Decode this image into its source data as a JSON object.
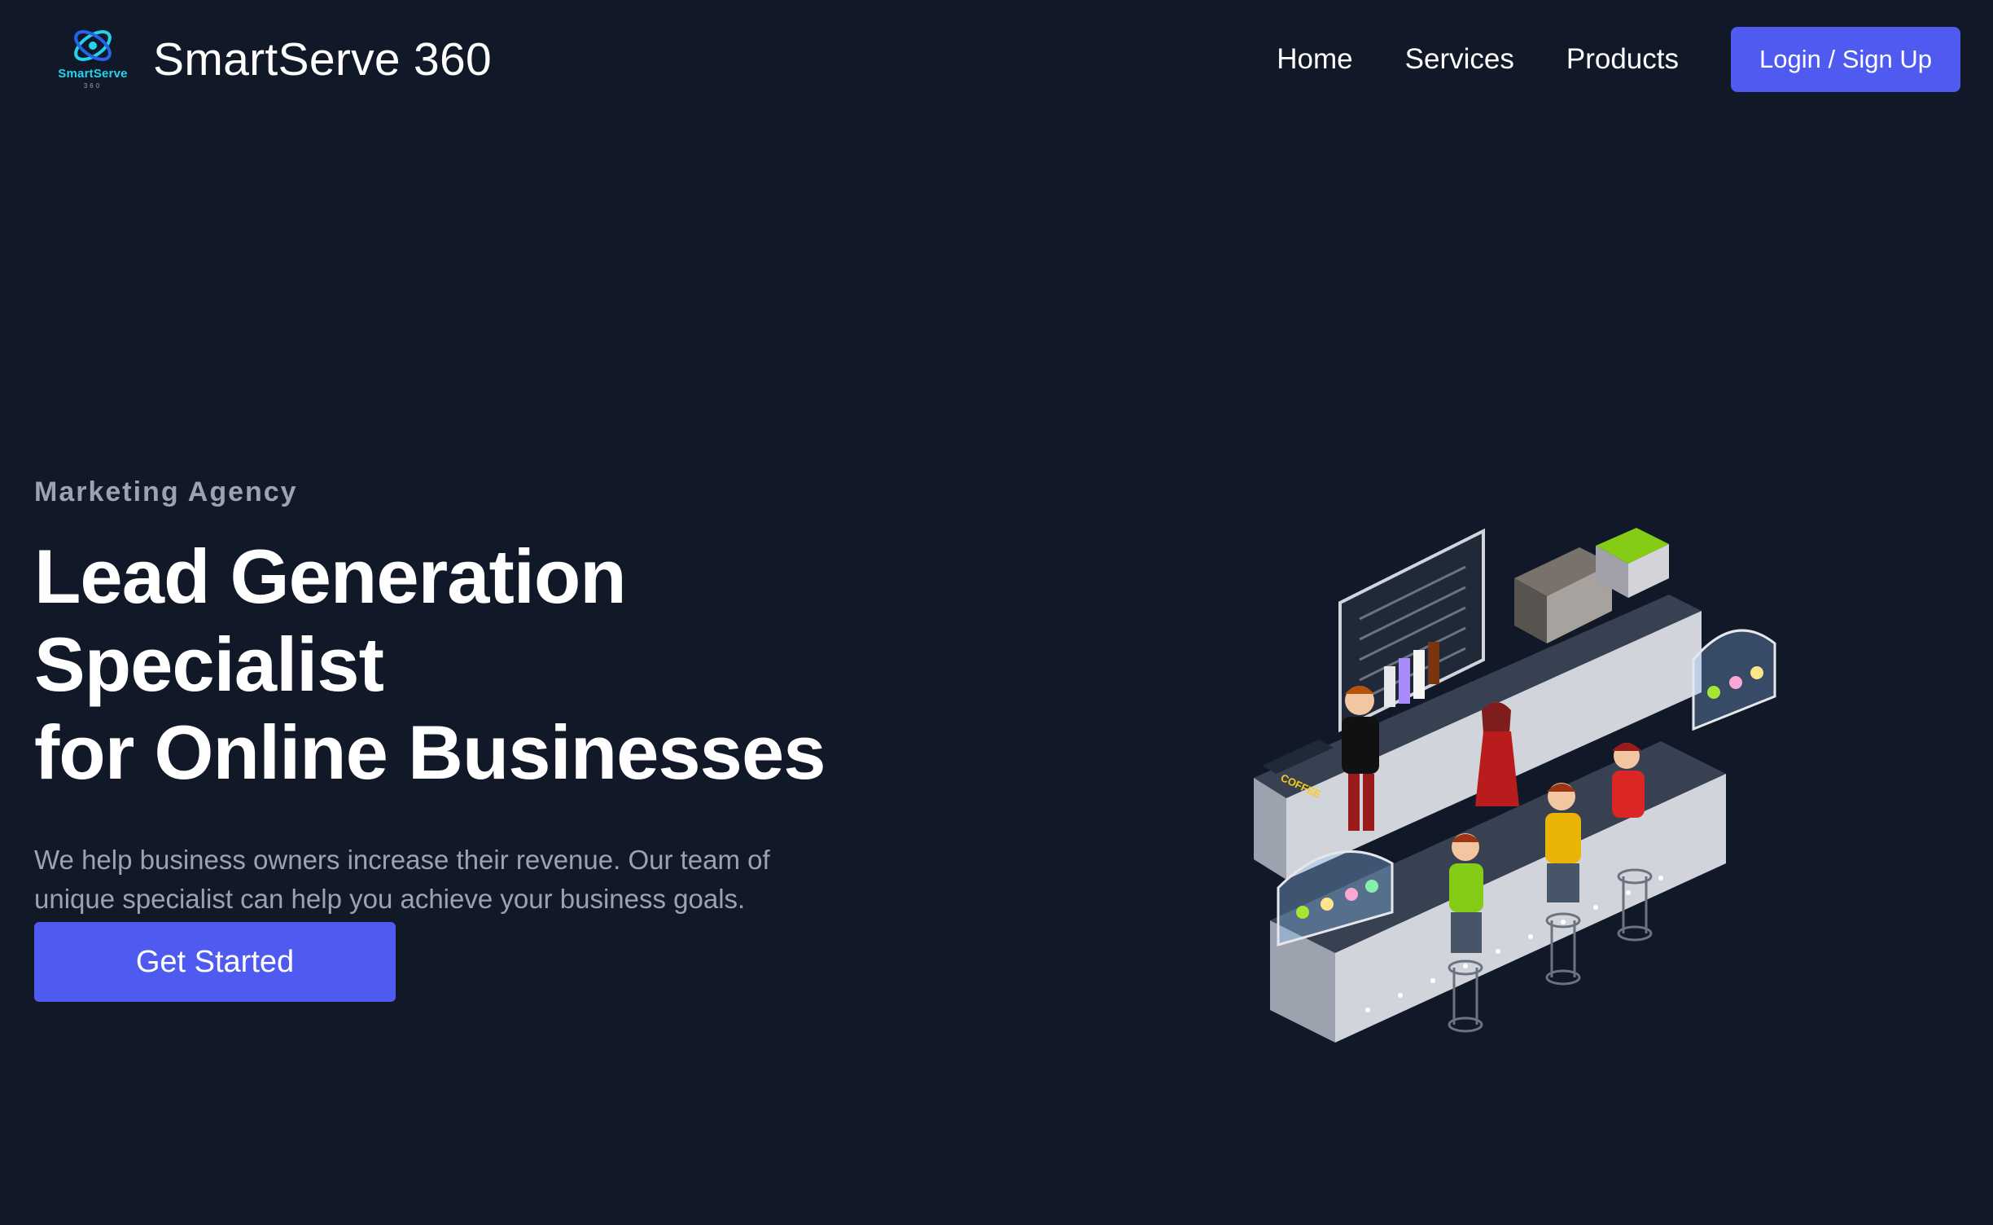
{
  "brand": {
    "logo_text": "SmartServe",
    "logo_subtext": "360",
    "name": "SmartServe 360",
    "accent_color": "#22d3ee"
  },
  "nav": {
    "items": [
      {
        "label": "Home"
      },
      {
        "label": "Services"
      },
      {
        "label": "Products"
      }
    ],
    "login_label": "Login / Sign Up"
  },
  "hero": {
    "eyebrow": "Marketing Agency",
    "headline_line1": "Lead Generation Specialist",
    "headline_line2": "for Online Businesses",
    "description": "We help business owners increase their revenue. Our team of unique specialist can help you achieve your business goals.",
    "cta_label": "Get Started"
  },
  "illustration": {
    "subject": "isometric coffee shop counter with barista and customers",
    "sign_text": "COFFEE"
  },
  "colors": {
    "background": "#111827",
    "primary_button": "#4f5bf0",
    "muted_text": "#9ca3af"
  }
}
